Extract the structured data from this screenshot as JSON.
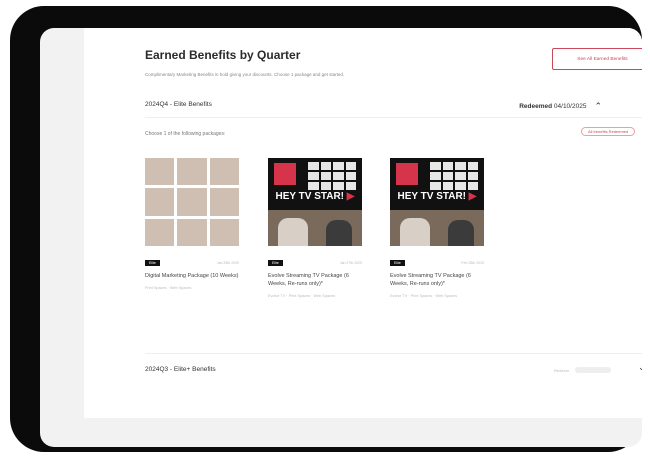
{
  "header": {
    "title": "Earned Benefits by Quarter",
    "subtitle": "Complimentary Marketing Benefits in hold giving your discounts. Choose 1 package and get started.",
    "see_all_label": "See All Earned Benefits"
  },
  "q4": {
    "label": "2024Q4 - Elite Benefits",
    "redeemed_label": "Redeemed",
    "redeemed_date": "04/10/2025",
    "choose_text": "Choose 1 of the following packages:",
    "all_redeemed_label": "All benefits Redeemed"
  },
  "cards": [
    {
      "tag": "Elite",
      "date": "Jan 28th 2025",
      "title": "Digital Marketing Package (10 Weeks)",
      "desc": "Print Spaces · Web Spaces"
    },
    {
      "tag": "Elite",
      "date": "Jan 27th 2025",
      "title": "Evolve Streaming TV Package (6 Weeks, Re-runs only)*",
      "desc": "Evolve TV · Print Spaces · Web Spaces",
      "headline": "HEY TV STAR!"
    },
    {
      "tag": "Elite",
      "date": "Feb 28th 2025",
      "title": "Evolve Streaming TV Package (6 Weeks, Re-runs only)*",
      "desc": "Evolve TV · Print Spaces · Web Spaces",
      "headline": "HEY TV STAR!"
    }
  ],
  "q3": {
    "label": "2024Q3 - Elite+ Benefits",
    "status_label": "Redeem"
  },
  "icons": {
    "chevron_up": "chevron-up-icon",
    "chevron_down": "chevron-down-icon",
    "play": "play-icon"
  },
  "colors": {
    "accent": "#c9485a",
    "bezel": "#0b0b0b"
  }
}
